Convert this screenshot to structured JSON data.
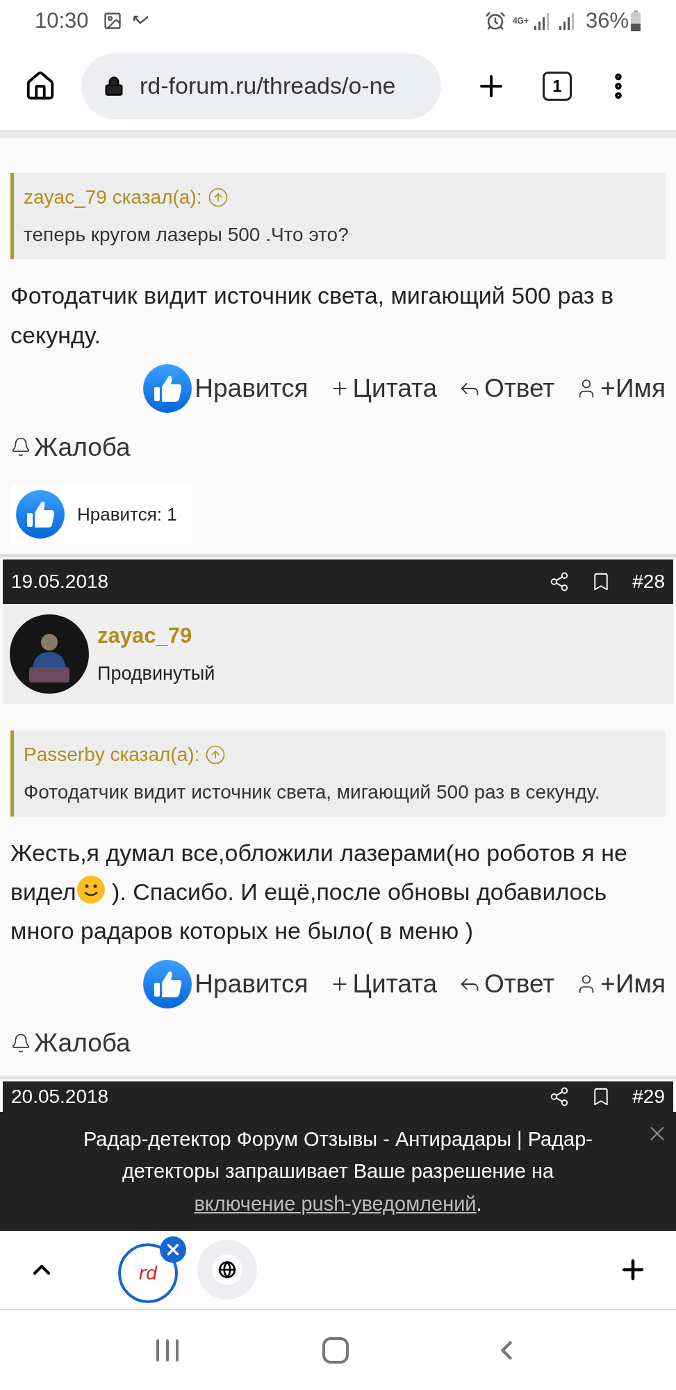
{
  "status_bar": {
    "time": "10:30",
    "network": "4G+",
    "battery": "36%"
  },
  "browser": {
    "url": "rd-forum.ru/threads/o-ne",
    "tab_count": "1"
  },
  "posts": [
    {
      "kind": "continuation",
      "quote": {
        "author": "zayac_79 сказал(а):",
        "text": "теперь кругом лазеры 500 .Что это?"
      },
      "body": [
        {
          "kind": "text",
          "text": "Фотодатчик видит источник света, мигающий 500 раз в секунду."
        }
      ],
      "actions": [
        {
          "kind": "like",
          "label": "Нравится"
        },
        {
          "kind": "quote",
          "label": "Цитата"
        },
        {
          "kind": "reply",
          "label": "Ответ"
        },
        {
          "kind": "mention",
          "label": "+Имя"
        },
        {
          "kind": "report",
          "label": "Жалоба"
        }
      ],
      "likes": "Нравится: 1"
    },
    {
      "kind": "full",
      "date": "19.05.2018",
      "number": "#28",
      "author": "zayac_79",
      "rank": "Продвинутый",
      "quote": {
        "author": "Passerby сказал(а):",
        "text": "Фотодатчик видит источник света, мигающий 500 раз в секунду."
      },
      "body": [
        {
          "kind": "text",
          "text": "Жесть,я думал все,обложили лазерами(но роботов я не видел"
        },
        {
          "kind": "smiley"
        },
        {
          "kind": "text",
          "text": " ). Спасибо. И ещё,после обновы добавилось много радаров которых не было( в меню )"
        }
      ],
      "actions": [
        {
          "kind": "like",
          "label": "Нравится"
        },
        {
          "kind": "quote",
          "label": "Цитата"
        },
        {
          "kind": "reply",
          "label": "Ответ"
        },
        {
          "kind": "mention",
          "label": "+Имя"
        },
        {
          "kind": "report",
          "label": "Жалоба"
        }
      ]
    }
  ],
  "next_post": {
    "date": "20.05.2018",
    "number": "#29"
  },
  "notification": {
    "text": "Радар-детектор Форум Отзывы - Антирадары | Радар-детекторы запрашивает Ваше разрешение на ",
    "link": "включение push-уведомлений",
    "suffix": "."
  },
  "tab_strip": {
    "logo": "rd"
  }
}
